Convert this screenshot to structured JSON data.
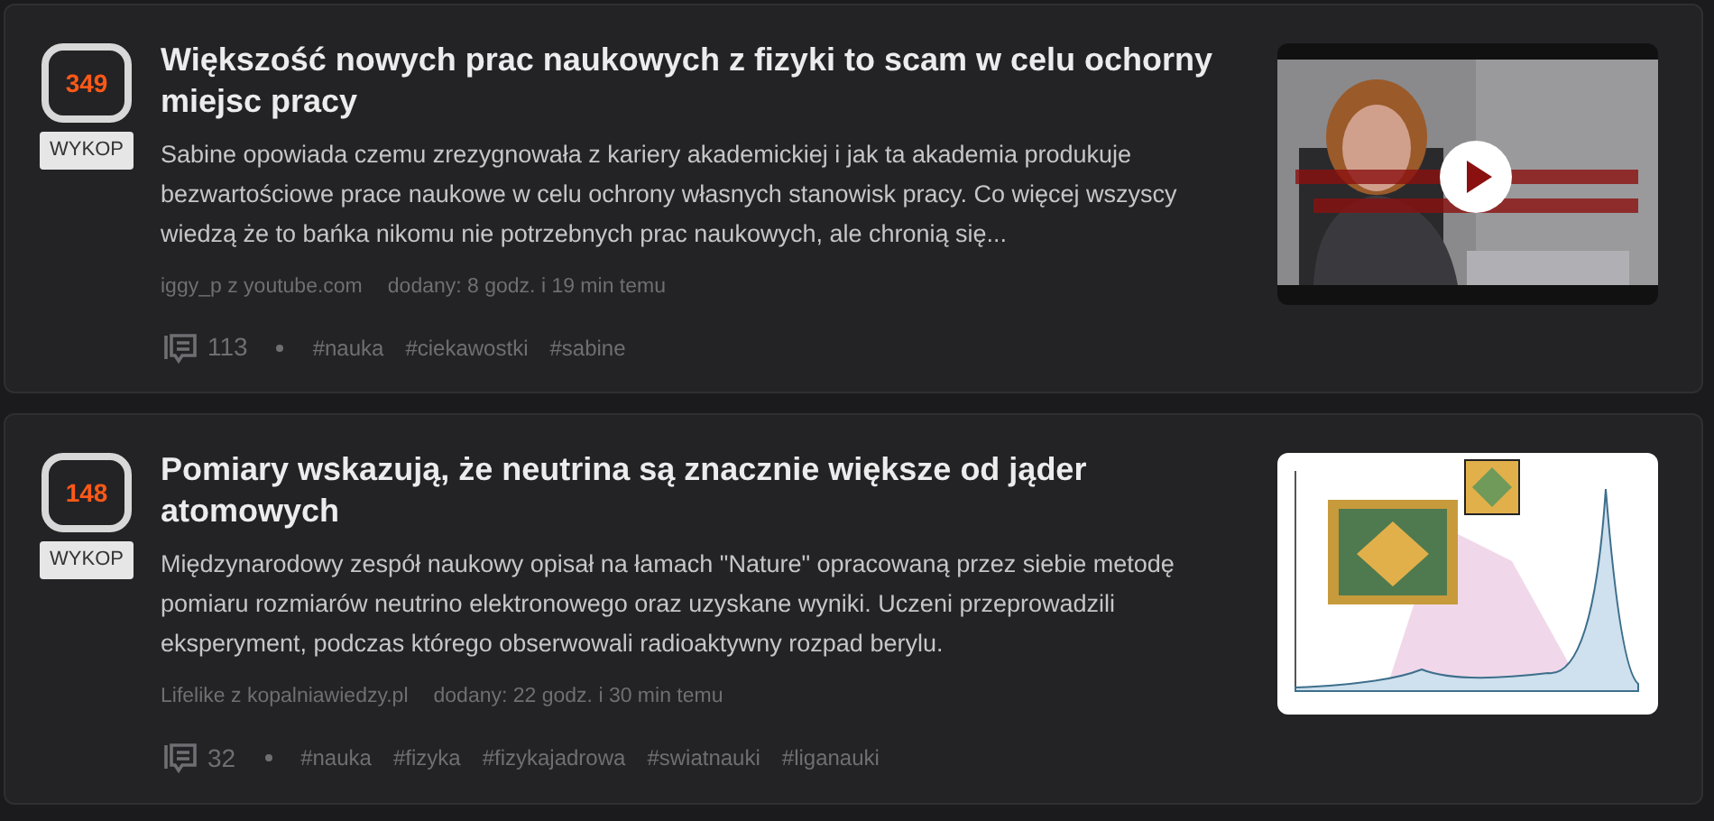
{
  "entries": [
    {
      "votes": "349",
      "badge": "WYKOP",
      "title": "Większość nowych prac naukowych z fizyki to scam w celu ochorny miejsc pracy",
      "description": "Sabine opowiada czemu zrezygnowała z kariery akademickiej i jak ta akademia produkuje bezwartościowe prace naukowe w celu ochrony własnych stanowisk pracy. Co więcej wszyscy wiedzą że to bańka nikomu nie potrzebnych prac naukowych, ale chronią się...",
      "author": "iggy_p",
      "source_prefix": "z",
      "source": "youtube.com",
      "added": "dodany: 8 godz. i 19 min temu",
      "comments": "113",
      "tags": [
        "#nauka",
        "#ciekawostki",
        "#sabine"
      ],
      "thumbnail": {
        "kind": "video"
      }
    },
    {
      "votes": "148",
      "badge": "WYKOP",
      "title": "Pomiary wskazują, że neutrina są znacznie większe od jąder atomowych",
      "description": "Międzynarodowy zespół naukowy opisał na łamach \"Nature\" opracowaną przez siebie metodę pomiaru rozmiarów neutrino elektronowego oraz uzyskane wyniki. Uczeni przeprowadzili eksperyment, podczas którego obserwowali radioaktywny rozpad berylu.",
      "author": "Lifelike",
      "source_prefix": "z",
      "source": "kopalniawiedzy.pl",
      "added": "dodany: 22 godz. i 30 min temu",
      "comments": "32",
      "tags": [
        "#nauka",
        "#fizyka",
        "#fizykajadrowa",
        "#swiatnauki",
        "#liganauki"
      ],
      "thumbnail": {
        "kind": "figure"
      }
    }
  ]
}
